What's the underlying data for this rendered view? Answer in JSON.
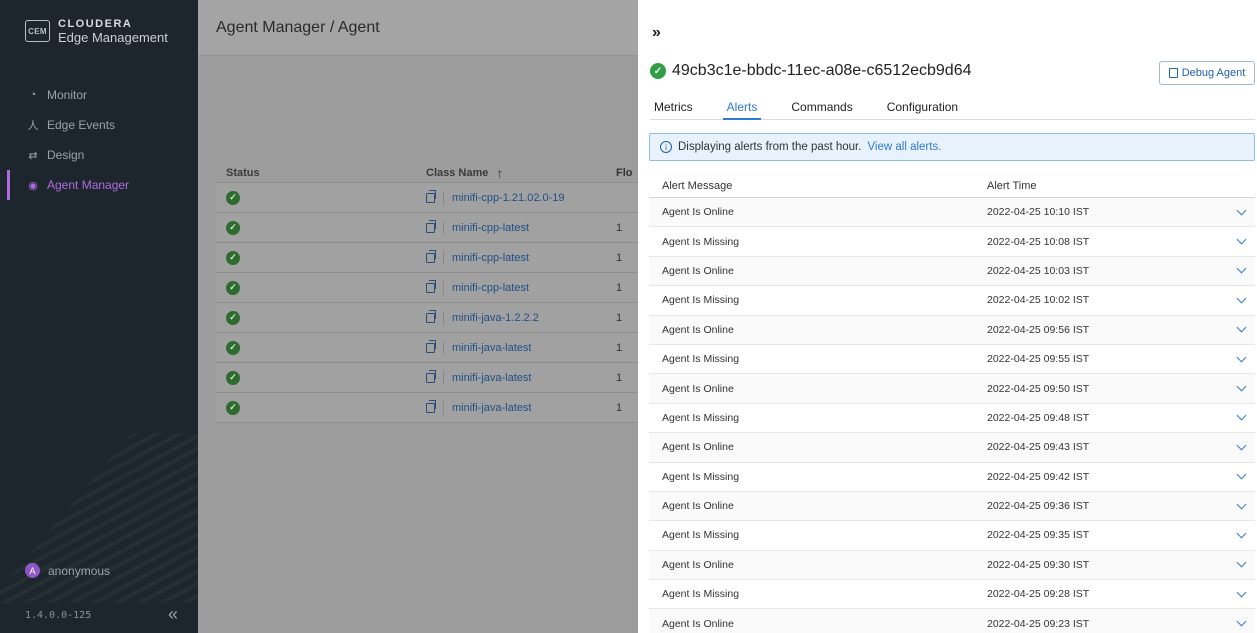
{
  "brand": {
    "logo": "CEM",
    "name": "CLOUDERA",
    "subtitle": "Edge Management"
  },
  "sidebar": {
    "items": [
      {
        "label": "Monitor",
        "icon": "gauge-icon"
      },
      {
        "label": "Edge Events",
        "icon": "person-icon"
      },
      {
        "label": "Design",
        "icon": "design-icon"
      },
      {
        "label": "Agent Manager",
        "icon": "broadcast-icon",
        "active": true
      }
    ],
    "user": {
      "initial": "A",
      "name": "anonymous"
    },
    "version": "1.4.0.0-125",
    "collapse_glyph": "«"
  },
  "main": {
    "breadcrumb": "Agent Manager / Agent",
    "table": {
      "headers": {
        "status": "Status",
        "class": "Class Name",
        "sort_glyph": "↑",
        "flow": "Flo"
      },
      "rows": [
        {
          "class": "minifi-cpp-1.21.02.0-19",
          "flow": ""
        },
        {
          "class": "minifi-cpp-latest",
          "flow": "1"
        },
        {
          "class": "minifi-cpp-latest",
          "flow": "1"
        },
        {
          "class": "minifi-cpp-latest",
          "flow": "1"
        },
        {
          "class": "minifi-java-1.2.2.2",
          "flow": "1"
        },
        {
          "class": "minifi-java-latest",
          "flow": "1"
        },
        {
          "class": "minifi-java-latest",
          "flow": "1"
        },
        {
          "class": "minifi-java-latest",
          "flow": "1"
        }
      ]
    }
  },
  "drawer": {
    "expand_glyph": "»",
    "agent_id": "49cb3c1e-bbdc-11ec-a08e-c6512ecb9d64",
    "debug_button": "Debug Agent",
    "tabs": [
      "Metrics",
      "Alerts",
      "Commands",
      "Configuration"
    ],
    "active_tab": "Alerts",
    "info": {
      "text": "Displaying alerts from the past hour.",
      "link": "View all alerts."
    },
    "alerts": {
      "headers": {
        "message": "Alert Message",
        "time": "Alert Time"
      },
      "rows": [
        {
          "message": "Agent Is Online",
          "time": "2022-04-25 10:10 IST"
        },
        {
          "message": "Agent Is Missing",
          "time": "2022-04-25 10:08 IST"
        },
        {
          "message": "Agent Is Online",
          "time": "2022-04-25 10:03 IST"
        },
        {
          "message": "Agent Is Missing",
          "time": "2022-04-25 10:02 IST"
        },
        {
          "message": "Agent Is Online",
          "time": "2022-04-25 09:56 IST"
        },
        {
          "message": "Agent Is Missing",
          "time": "2022-04-25 09:55 IST"
        },
        {
          "message": "Agent Is Online",
          "time": "2022-04-25 09:50 IST"
        },
        {
          "message": "Agent Is Missing",
          "time": "2022-04-25 09:48 IST"
        },
        {
          "message": "Agent Is Online",
          "time": "2022-04-25 09:43 IST"
        },
        {
          "message": "Agent Is Missing",
          "time": "2022-04-25 09:42 IST"
        },
        {
          "message": "Agent Is Online",
          "time": "2022-04-25 09:36 IST"
        },
        {
          "message": "Agent Is Missing",
          "time": "2022-04-25 09:35 IST"
        },
        {
          "message": "Agent Is Online",
          "time": "2022-04-25 09:30 IST"
        },
        {
          "message": "Agent Is Missing",
          "time": "2022-04-25 09:28 IST"
        },
        {
          "message": "Agent Is Online",
          "time": "2022-04-25 09:23 IST"
        }
      ]
    }
  },
  "colors": {
    "accent": "#b06be0",
    "link": "#2f7ad3",
    "success": "#2f9e44",
    "sidebar_bg": "#1c262c"
  }
}
